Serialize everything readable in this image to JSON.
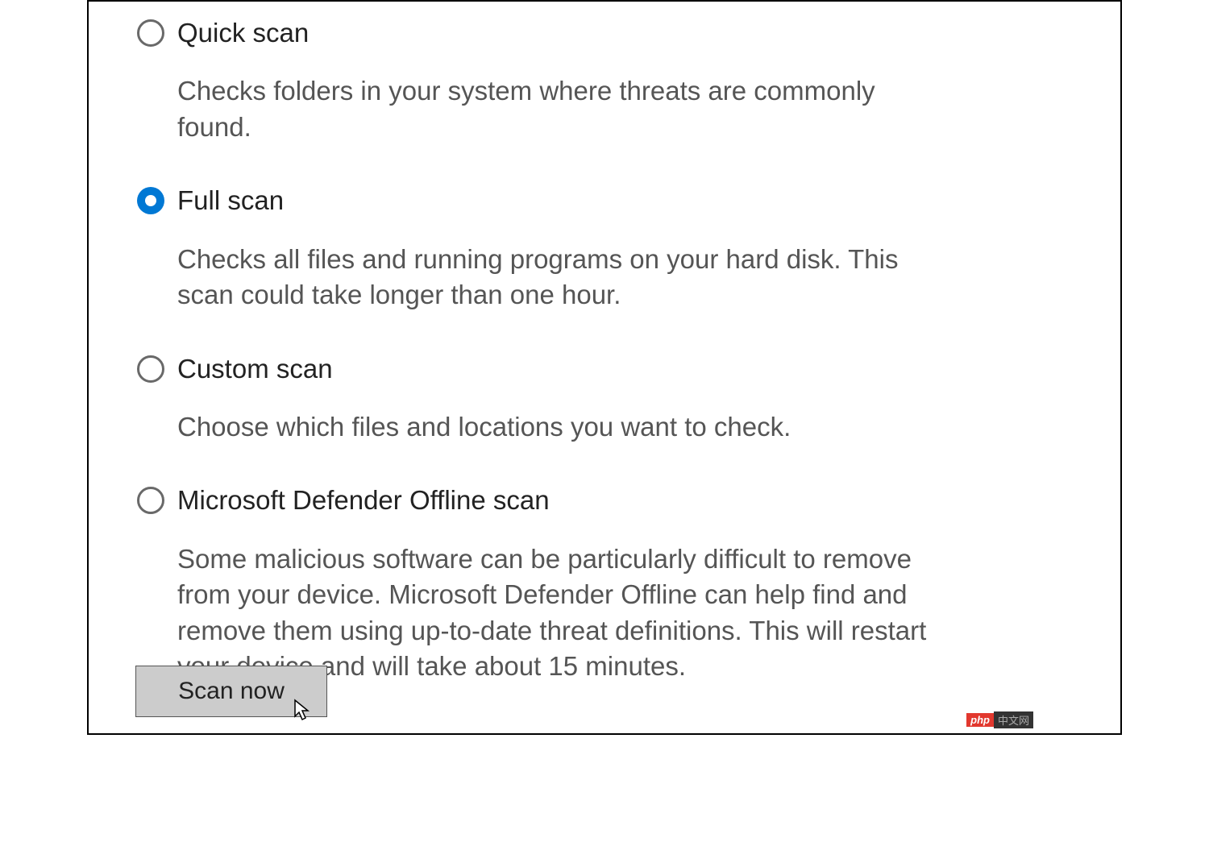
{
  "options": [
    {
      "title": "Quick scan",
      "description": "Checks folders in your system where threats are commonly found.",
      "selected": false
    },
    {
      "title": "Full scan",
      "description": "Checks all files and running programs on your hard disk. This scan could take longer than one hour.",
      "selected": true
    },
    {
      "title": "Custom scan",
      "description": "Choose which files and locations you want to check.",
      "selected": false
    },
    {
      "title": "Microsoft Defender Offline scan",
      "description": "Some malicious software can be particularly difficult to remove from your device. Microsoft Defender Offline can help find and remove them using up-to-date threat definitions. This will restart your device and will take about 15 minutes.",
      "selected": false
    }
  ],
  "button": {
    "scan_now": "Scan now"
  },
  "watermark": {
    "left": "php",
    "right": "中文网"
  }
}
